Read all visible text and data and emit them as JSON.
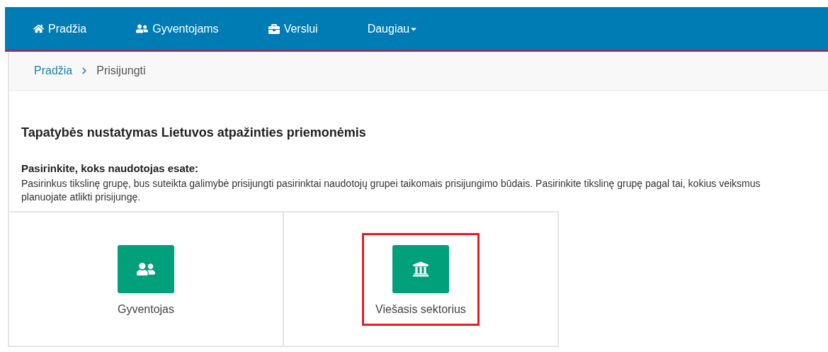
{
  "nav": {
    "items": [
      {
        "label": "Pradžia",
        "kind": "home"
      },
      {
        "label": "Gyventojams",
        "kind": "people"
      },
      {
        "label": "Verslui",
        "kind": "briefcase"
      },
      {
        "label": "Daugiau",
        "kind": "dropdown"
      }
    ]
  },
  "breadcrumb": [
    {
      "label": "Pradžia",
      "kind": "link"
    },
    {
      "label": "Prisijungti",
      "kind": "current"
    }
  ],
  "heading": "Tapatybės nustatymas Lietuvos atpažinties priemonėmis",
  "subheading": "Pasirinkite, koks naudotojas esate:",
  "description": "Pasirinkus tikslinę grupę, bus suteikta galimybė prisijungti pasirinktai naudotojų grupei taikomais prisijungimo būdais. Pasirinkite tikslinę grupę pagal tai, kokius veiksmus planuojate atlikti prisijungę.",
  "options": [
    {
      "label": "Gyventojas",
      "kind": "people",
      "highlighted": false
    },
    {
      "label": "Viešasis sektorius",
      "kind": "institution",
      "highlighted": true
    }
  ]
}
